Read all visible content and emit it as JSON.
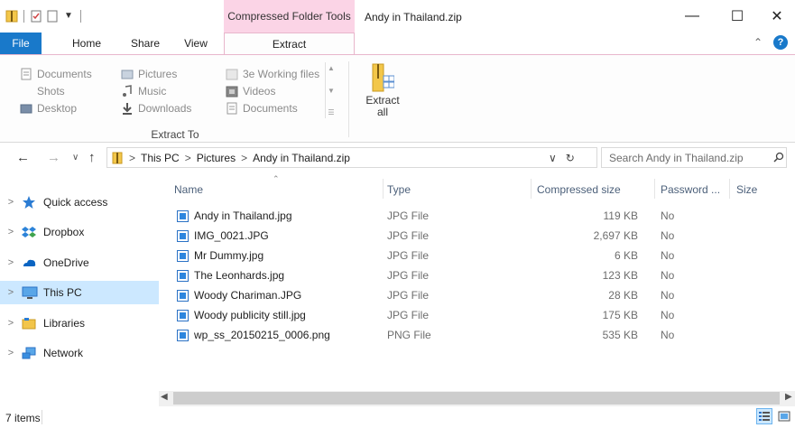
{
  "window": {
    "title": "Andy in Thailand.zip",
    "context_header": "Compressed Folder Tools",
    "controls": {
      "minimize": "—",
      "maximize": "☐",
      "close": "✕"
    }
  },
  "tabs": {
    "file": "File",
    "home": "Home",
    "share": "Share",
    "view": "View",
    "extract": "Extract"
  },
  "ribbon": {
    "extract_to": {
      "group_label": "Extract To",
      "items": [
        {
          "label": "Documents",
          "icon": "documents-icon"
        },
        {
          "label": "Shots",
          "icon": "folder-icon"
        },
        {
          "label": "Desktop",
          "icon": "desktop-icon"
        },
        {
          "label": "Pictures",
          "icon": "pictures-icon"
        },
        {
          "label": "Music",
          "icon": "music-icon"
        },
        {
          "label": "Downloads",
          "icon": "downloads-icon"
        },
        {
          "label": "3e Working files",
          "icon": "folder-icon"
        },
        {
          "label": "Videos",
          "icon": "videos-icon"
        },
        {
          "label": "Documents",
          "icon": "documents-icon"
        }
      ]
    },
    "extract_all": {
      "line1": "Extract",
      "line2": "all"
    }
  },
  "address": {
    "crumbs": [
      "This PC",
      "Pictures",
      "Andy in Thailand.zip"
    ],
    "separator": ">",
    "refresh": "↻",
    "dropdown": "∨"
  },
  "search": {
    "placeholder": "Search Andy in Thailand.zip"
  },
  "nav": {
    "items": [
      {
        "label": "Quick access",
        "icon": "star-icon"
      },
      {
        "label": "Dropbox",
        "icon": "dropbox-icon"
      },
      {
        "label": "OneDrive",
        "icon": "onedrive-icon"
      },
      {
        "label": "This PC",
        "icon": "computer-icon",
        "selected": true
      },
      {
        "label": "Libraries",
        "icon": "libraries-icon"
      },
      {
        "label": "Network",
        "icon": "network-icon"
      }
    ]
  },
  "columns": {
    "name": "Name",
    "type": "Type",
    "compressed_size": "Compressed size",
    "password": "Password ...",
    "size": "Size"
  },
  "files": [
    {
      "name": "Andy in Thailand.jpg",
      "type": "JPG File",
      "compressed_size": "119 KB",
      "password": "No"
    },
    {
      "name": "IMG_0021.JPG",
      "type": "JPG File",
      "compressed_size": "2,697 KB",
      "password": "No"
    },
    {
      "name": "Mr Dummy.jpg",
      "type": "JPG File",
      "compressed_size": "6 KB",
      "password": "No"
    },
    {
      "name": "The Leonhards.jpg",
      "type": "JPG File",
      "compressed_size": "123 KB",
      "password": "No"
    },
    {
      "name": "Woody Chariman.JPG",
      "type": "JPG File",
      "compressed_size": "28 KB",
      "password": "No"
    },
    {
      "name": "Woody publicity still.jpg",
      "type": "JPG File",
      "compressed_size": "175 KB",
      "password": "No"
    },
    {
      "name": "wp_ss_20150215_0006.png",
      "type": "PNG File",
      "compressed_size": "535 KB",
      "password": "No"
    }
  ],
  "status": {
    "item_count": "7 items"
  },
  "colors": {
    "file_tab": "#1979ca",
    "context_tab": "#fbd4e6",
    "nav_selected": "#cce8ff"
  }
}
